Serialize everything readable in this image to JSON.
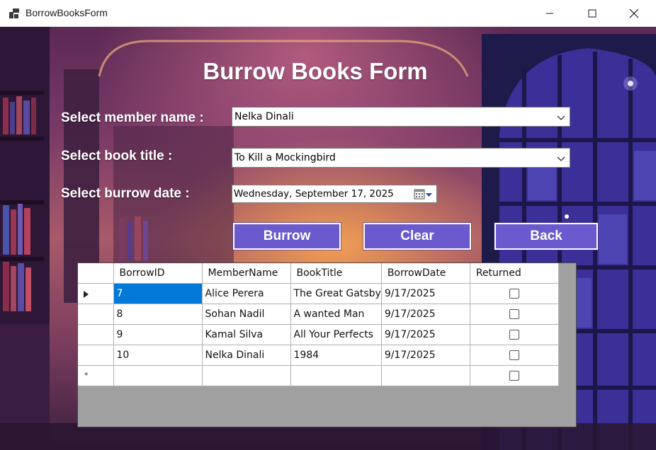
{
  "window": {
    "title": "BorrowBooksForm",
    "controls": [
      "minimize-icon",
      "maximize-icon",
      "close-icon"
    ]
  },
  "form": {
    "heading": "Burrow Books Form",
    "member_label": "Select member name :",
    "member_value": "Nelka Dinali",
    "book_label": "Select book title :",
    "book_value": "To Kill a Mockingbird",
    "date_label": "Select burrow date :",
    "date_value": "Wednesday, September 17, 2025"
  },
  "buttons": {
    "burrow": "Burrow",
    "clear": "Clear",
    "back": "Back"
  },
  "grid": {
    "columns": [
      "BorrowID",
      "MemberName",
      "BookTitle",
      "BorrowDate",
      "Returned"
    ],
    "rows": [
      {
        "BorrowID": "7",
        "MemberName": "Alice Perera",
        "BookTitle": "The Great Gatsby",
        "BorrowDate": "9/17/2025",
        "Returned": false
      },
      {
        "BorrowID": "8",
        "MemberName": "Sohan Nadil",
        "BookTitle": "A wanted Man",
        "BorrowDate": "9/17/2025",
        "Returned": false
      },
      {
        "BorrowID": "9",
        "MemberName": "Kamal Silva",
        "BookTitle": "All Your Perfects",
        "BorrowDate": "9/17/2025",
        "Returned": false
      },
      {
        "BorrowID": "10",
        "MemberName": "Nelka Dinali",
        "BookTitle": "1984",
        "BorrowDate": "9/17/2025",
        "Returned": false
      }
    ],
    "selected_cell": "BorrowID of row 1",
    "new_row_marker": "*"
  },
  "colors": {
    "button_fill": "#6a5acd",
    "selection": "#0078d7",
    "grid_background": "#a0a0a0"
  }
}
